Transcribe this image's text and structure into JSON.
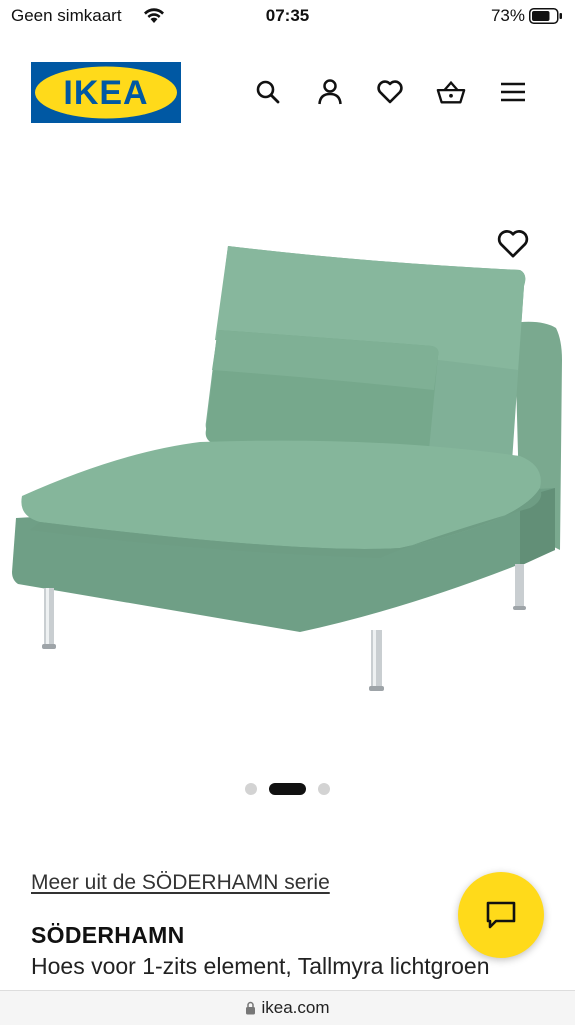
{
  "status": {
    "carrier": "Geen simkaart",
    "time": "07:35",
    "battery": "73%"
  },
  "header": {
    "logo_text": "IKEA",
    "icons": [
      "search-icon",
      "user-icon",
      "heart-icon",
      "basket-icon",
      "menu-icon"
    ]
  },
  "colors": {
    "brand_blue": "#0058A3",
    "brand_yellow": "#FFDA1A",
    "product_green": "#7FAF94"
  },
  "gallery": {
    "image_count": 3,
    "active_index": 1
  },
  "product": {
    "series_link": "Meer uit de SÖDERHAMN serie",
    "name": "SÖDERHAMN",
    "description": "Hoes voor 1-zits element, Tallmyra lichtgroen"
  },
  "chat": {
    "icon": "chat-icon"
  },
  "browser": {
    "url": "ikea.com"
  }
}
